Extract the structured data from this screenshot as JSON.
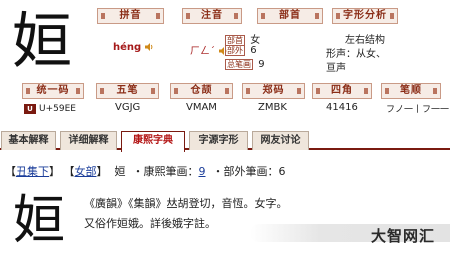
{
  "character": "姮",
  "info": {
    "pinyin_label": "拼音",
    "pinyin": "héng",
    "zhuyin_label": "注音",
    "zhuyin": "ㄏㄥˊ",
    "bushou_label": "部首",
    "bushou_tag": "部首",
    "bushou": "女",
    "buwai_tag": "部外",
    "buwai": "6",
    "zongbihua_tag": "总笔画",
    "zongbihua": "9",
    "analysis_label": "字形分析",
    "analysis_line1": "左右结构",
    "analysis_line2": "形声：从女、",
    "analysis_line3": "亘声"
  },
  "codes": {
    "unicode_label": "统一码",
    "unicode_badge": "U",
    "unicode": "U+59EE",
    "wubi_label": "五笔",
    "wubi": "VGJG",
    "cangjie_label": "仓颉",
    "cangjie": "VMAM",
    "zhengma_label": "郑码",
    "zhengma": "ZMBK",
    "sijiao_label": "四角",
    "sijiao": "41416",
    "bishun_label": "笔顺",
    "bishun": "フノ一丨フ一一"
  },
  "tabs": [
    {
      "label": "基本解释",
      "active": false
    },
    {
      "label": "详细解释",
      "active": false
    },
    {
      "label": "康熙字典",
      "active": true
    },
    {
      "label": "字源字形",
      "active": false
    },
    {
      "label": "网友讨论",
      "active": false
    }
  ],
  "kangxi": {
    "bracket_open": "【",
    "bracket_close": "】",
    "volume": "丑集下",
    "radical_link": "女部",
    "char": "姮",
    "kx_strokes_label": "・康熙筆画：",
    "kx_strokes": "9",
    "buwai_label": "・部外筆画：",
    "buwai": "6",
    "text_line1": "《廣韻》《集韻》𠀤胡登切，音恆。女字。",
    "text_line2": "又俗作姮娥。詳後娥字註。"
  },
  "watermark": "大智网汇"
}
